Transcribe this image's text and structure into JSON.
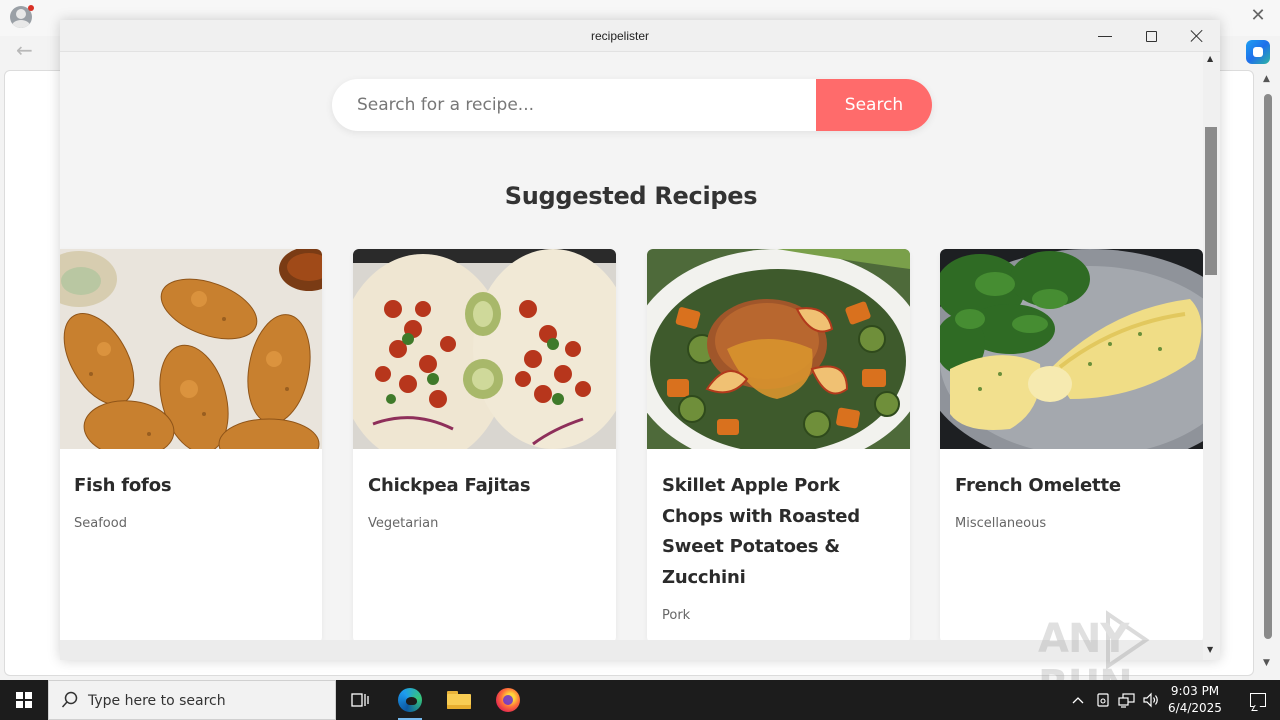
{
  "app": {
    "title": "recipelister"
  },
  "search": {
    "placeholder": "Search for a recipe...",
    "value": "",
    "button_label": "Search"
  },
  "section": {
    "title": "Suggested Recipes"
  },
  "recipes": [
    {
      "name": "Fish fofos",
      "category": "Seafood",
      "image": "fried-fish-croquettes"
    },
    {
      "name": "Chickpea Fajitas",
      "category": "Vegetarian",
      "image": "chickpea-tortillas"
    },
    {
      "name": "Skillet Apple Pork Chops with Roasted Sweet Potatoes & Zucchini",
      "category": "Pork",
      "image": "pork-chop-vegetables"
    },
    {
      "name": "French Omelette",
      "category": "Miscellaneous",
      "image": "omelette-greens"
    }
  ],
  "taskbar": {
    "search_placeholder": "Type here to search",
    "time": "9:03 PM",
    "date": "6/4/2025",
    "apps": [
      "task-view-icon",
      "edge-icon",
      "file-explorer-icon",
      "firefox-icon"
    ]
  },
  "watermark": {
    "text": "ANY RUN"
  },
  "colors": {
    "accent": "#ff6b6b",
    "background": "#f4f4f4",
    "card": "#ffffff",
    "taskbar": "#1c1c1c"
  }
}
